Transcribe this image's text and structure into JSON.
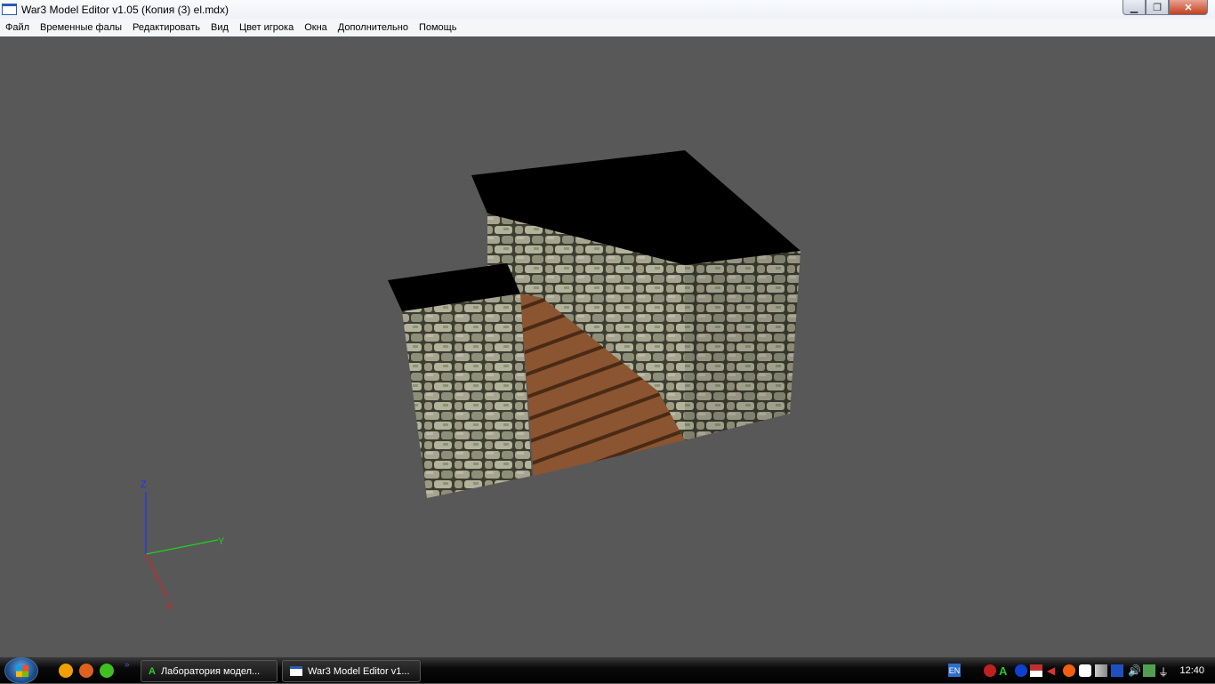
{
  "window": {
    "title": "War3 Model Editor v1.05 (Копия (3) el.mdx)",
    "minimize_icon": "minimize-icon",
    "maximize_icon": "restore-icon",
    "close_icon": "close-icon"
  },
  "menu": [
    "Файл",
    "Временные фалы",
    "Редактировать",
    "Вид",
    "Цвет игрока",
    "Окна",
    "Дополнительно",
    "Помощь"
  ],
  "axes": {
    "z": "Z",
    "y": "Y",
    "x": "X",
    "colors": {
      "z": "#2030ff",
      "y": "#20d020",
      "x": "#e02020"
    }
  },
  "taskbar": {
    "buttons": [
      "Лаборатория модел...",
      "War3 Model Editor v1..."
    ],
    "language": "EN",
    "clock": "12:40"
  }
}
